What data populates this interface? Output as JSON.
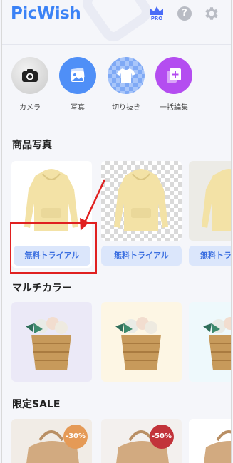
{
  "header": {
    "logo": "PicWish",
    "pro_label": "PRO",
    "help_label": "?"
  },
  "tools": [
    {
      "label": "カメラ",
      "icon": "camera-icon",
      "color": "#d8d8d8"
    },
    {
      "label": "写真",
      "icon": "photo-icon",
      "color": "#4f8ff7"
    },
    {
      "label": "切り抜き",
      "icon": "cutout-shirt-icon",
      "color": "#8ab4f8"
    },
    {
      "label": "一括編集",
      "icon": "batch-edit-icon",
      "color": "#b44df0"
    }
  ],
  "sections": {
    "product_photo": {
      "title": "商品写真",
      "button_label": "無料トライアル"
    },
    "multicolor": {
      "title": "マルチカラー"
    },
    "sale": {
      "title": "限定SALE",
      "badges": [
        "-30%",
        "-50%"
      ]
    }
  },
  "colors": {
    "accent": "#3b82f6",
    "button_bg": "#dbe6fb",
    "annotation": "#e02020"
  }
}
